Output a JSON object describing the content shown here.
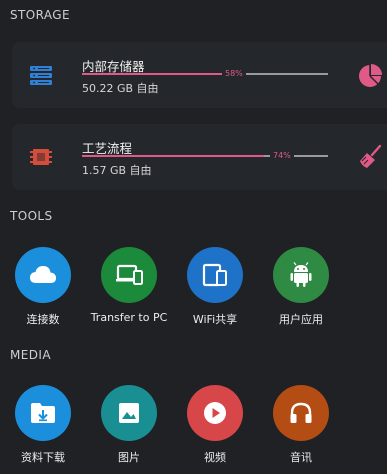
{
  "sections": {
    "storage_title": "STORAGE",
    "tools_title": "TOOLS",
    "media_title": "MEDIA"
  },
  "storage": [
    {
      "name": "内部存储器",
      "detail": "50.22 GB 自由",
      "percent_label": "58%",
      "used_fraction": 0.58,
      "icon": "server-icon",
      "action_icon": "pie-chart-icon"
    },
    {
      "name": "工艺流程",
      "detail": "1.57 GB 自由",
      "percent_label": "74%",
      "used_fraction": 0.74,
      "icon": "memory-chip-icon",
      "action_icon": "broom-icon"
    }
  ],
  "tools": [
    {
      "label": "连接数",
      "icon": "cloud-icon",
      "color": "#1b8fdc"
    },
    {
      "label": "Transfer to PC",
      "icon": "devices-icon",
      "color": "#1b8a3a"
    },
    {
      "label": "WiFi共享",
      "icon": "phone-tablet-icon",
      "color": "#1e72c8"
    },
    {
      "label": "用户应用",
      "icon": "android-icon",
      "color": "#2f8a43"
    }
  ],
  "media": [
    {
      "label": "资料下载",
      "icon": "download-folder-icon",
      "color": "#1b8fdc"
    },
    {
      "label": "图片",
      "icon": "image-icon",
      "color": "#1a8f93"
    },
    {
      "label": "视频",
      "icon": "play-icon",
      "color": "#d7474a"
    },
    {
      "label": "音讯",
      "icon": "headphones-icon",
      "color": "#b34d14"
    }
  ],
  "colors": {
    "background": "#1f2124",
    "card": "#24272b",
    "accent": "#e05a87",
    "track": "#9a9a9a"
  }
}
